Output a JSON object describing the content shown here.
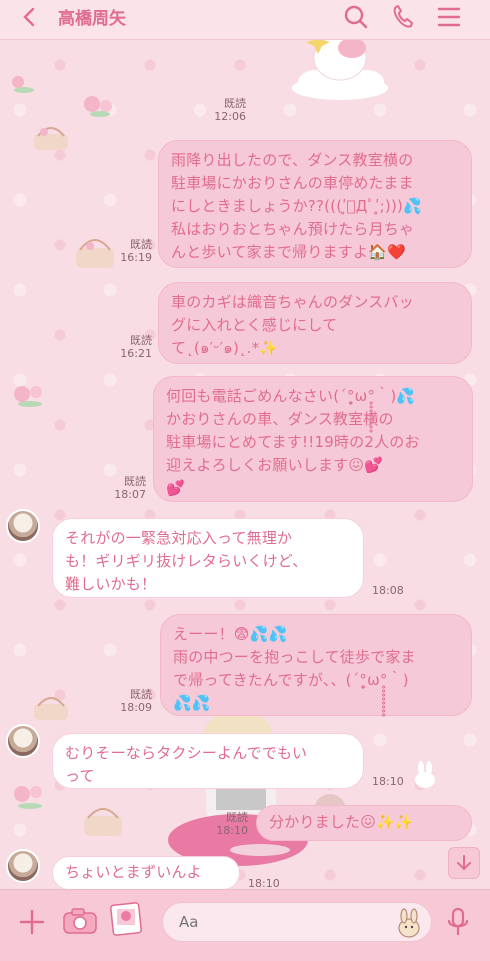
{
  "header": {
    "title": "高橋周矢",
    "back_icon": "chevron-left-icon",
    "search_icon": "search-icon",
    "call_icon": "phone-icon",
    "menu_icon": "menu-icon"
  },
  "colors": {
    "accent": "#e06d8f",
    "bubble_me": "#f6c9d8",
    "bubble_them": "#ffffff",
    "background": "#f8dde4"
  },
  "messages": [
    {
      "side": "me",
      "read": "既読",
      "time": "12:06",
      "lines": []
    },
    {
      "side": "me",
      "read": "既読",
      "time": "16:19",
      "lines": [
        "雨降り出したので、ダンス教室横の",
        "駐車場にかおりさんの車停めたまま",
        "にしときましょうか??(((ʹ̥ﾟДﾟʹ̥;)))💦",
        "私はおりおとちゃん預けたら月ちゃ",
        "んと歩いて家まで帰りますよ🏠❤️"
      ]
    },
    {
      "side": "me",
      "read": "既読",
      "time": "16:21",
      "lines": [
        "車のカギは織音ちゃんのダンスバッ",
        "グに入れとく感じにして",
        "て˛(๑′ᵕ′๑)˛.*✨"
      ]
    },
    {
      "side": "me",
      "read": "既読",
      "time": "18:07",
      "lines": [
        "何回も電話ごめんなさい(´°̥̥̥̥̥̥̥̥ω°̥̥̥̥̥̥̥̥｀)💦",
        "かおりさんの車、ダンス教室横の",
        "駐車場にとめてます!!19時の2人のお",
        "迎えよろしくお願いします😖💕",
        "💕"
      ]
    },
    {
      "side": "them",
      "time": "18:08",
      "lines": [
        "それがの一緊急対応入って無理か",
        "も！ギリギリ抜けレタらいくけど、",
        "難しいかも！"
      ]
    },
    {
      "side": "me",
      "read": "既読",
      "time": "18:09",
      "lines": [
        "えーー！😨💦💦",
        "雨の中つーを抱っこして徒歩で家ま",
        "で帰ってきたんですが、、(´°̥̥̥̥̥̥̥̥ω°̥̥̥̥̥̥̥̥｀)",
        "💦💦"
      ]
    },
    {
      "side": "them",
      "time": "18:10",
      "lines": [
        "むりそーならタクシーよんででもい",
        "って"
      ]
    },
    {
      "side": "me",
      "read": "既読",
      "time": "18:10",
      "lines": [
        "分かりました😖✨✨"
      ]
    },
    {
      "side": "them",
      "time": "18:10",
      "lines": [
        "ちょいとまずいんよ"
      ]
    }
  ],
  "footer": {
    "plus_icon": "plus-icon",
    "camera_icon": "camera-icon",
    "photo_icon": "photo-icon",
    "input_placeholder": "Aa",
    "sticker_icon": "sticker-icon",
    "mic_icon": "microphone-icon"
  },
  "scroll_down_icon": "arrow-down-icon"
}
